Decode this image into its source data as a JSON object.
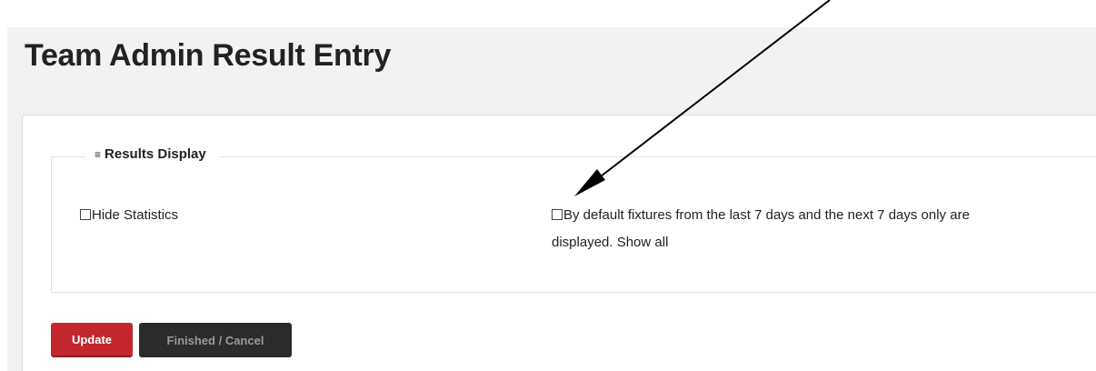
{
  "page": {
    "title": "Team Admin Result Entry"
  },
  "results_display": {
    "legend_icon": "list-icon",
    "legend_label": "Results Display",
    "hide_statistics_label": "Hide Statistics",
    "hide_statistics_checked": false,
    "show_all_label": "By default fixtures from the last 7 days and the next 7 days only are displayed. Show all",
    "show_all_checked": false
  },
  "buttons": {
    "update_label": "Update",
    "cancel_label": "Finished / Cancel"
  },
  "colors": {
    "update_button": "#c1272d",
    "cancel_button": "#2b2b2b",
    "annotation_arrow": "#000000"
  }
}
